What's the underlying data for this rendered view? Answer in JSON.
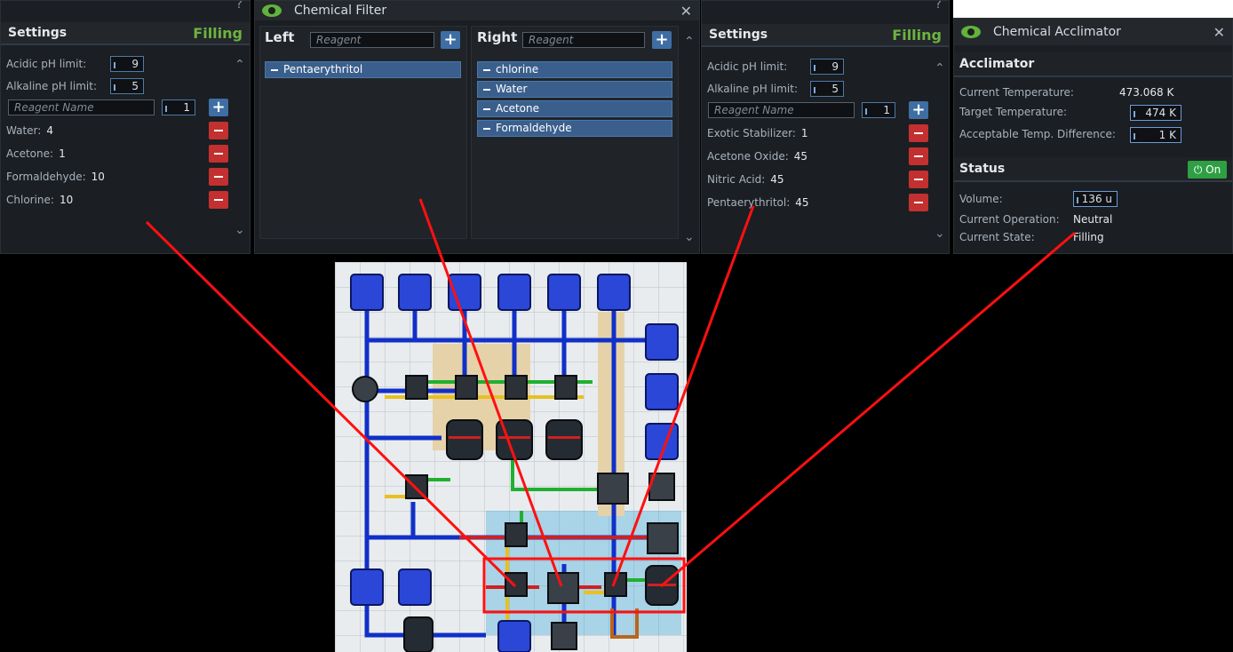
{
  "settings_left": {
    "title": "Settings",
    "state": "Filling",
    "acidic_label": "Acidic pH limit:",
    "acidic_value": "9",
    "alkaline_label": "Alkaline pH limit:",
    "alkaline_value": "5",
    "reagent_placeholder": "Reagent Name",
    "amount_value": "1",
    "reagents": [
      {
        "name": "Water:",
        "amount": "4"
      },
      {
        "name": "Acetone:",
        "amount": "1"
      },
      {
        "name": "Formaldehyde:",
        "amount": "10"
      },
      {
        "name": "Chlorine:",
        "amount": "10"
      }
    ],
    "help_glyph": "?"
  },
  "filter": {
    "title": "Chemical Filter",
    "close": "✕",
    "left_label": "Left",
    "right_label": "Right",
    "placeholder": "Reagent",
    "left_items": [
      "Pentaerythritol"
    ],
    "right_items": [
      "chlorine",
      "Water",
      "Acetone",
      "Formaldehyde"
    ]
  },
  "settings_right": {
    "title": "Settings",
    "state": "Filling",
    "acidic_label": "Acidic pH limit:",
    "acidic_value": "9",
    "alkaline_label": "Alkaline pH limit:",
    "alkaline_value": "5",
    "reagent_placeholder": "Reagent Name",
    "amount_value": "1",
    "reagents": [
      {
        "name": "Exotic Stabilizer:",
        "amount": "1"
      },
      {
        "name": "Acetone Oxide:",
        "amount": "45"
      },
      {
        "name": "Nitric Acid:",
        "amount": "45"
      },
      {
        "name": "Pentaerythritol:",
        "amount": "45"
      }
    ],
    "help_glyph": "?"
  },
  "acclimator": {
    "title": "Chemical Acclimator",
    "close": "✕",
    "section1": "Acclimator",
    "current_temp_label": "Current Temperature:",
    "current_temp": "473.068 K",
    "target_temp_label": "Target Temperature:",
    "target_temp": "474 K",
    "diff_label": "Acceptable Temp. Difference:",
    "diff_value": "1 K",
    "section2": "Status",
    "power_label": "On",
    "volume_label": "Volume:",
    "volume_value": "136 u",
    "operation_label": "Current Operation:",
    "operation_value": "Neutral",
    "state_label": "Current State:",
    "state_value": "Filling"
  },
  "colors": {
    "accent_green": "#6cb33f",
    "remove_red": "#c33030",
    "add_blue": "#3e6ea3",
    "pipe_blue": "#1030c8",
    "pipe_red": "#d02020",
    "pipe_green": "#20b030",
    "pipe_yellow": "#e8c020",
    "annotation_red": "#ff1010"
  }
}
